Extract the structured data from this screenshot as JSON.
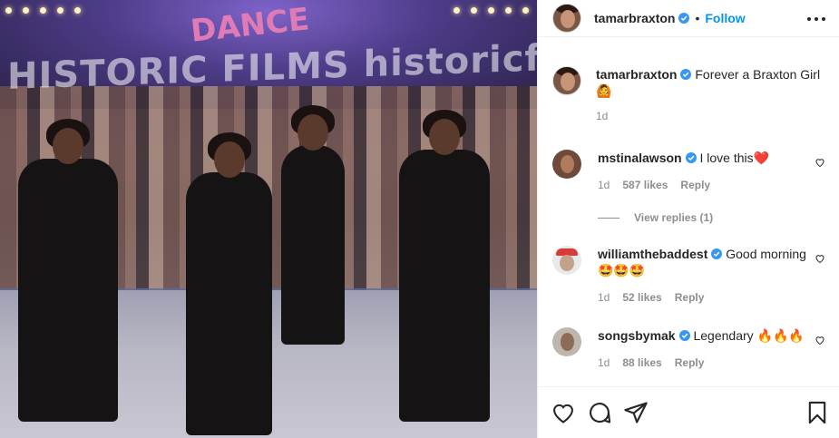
{
  "media": {
    "watermark": "HISTORIC FILMS  historicfilms.com",
    "sign": "DANCE"
  },
  "post": {
    "author": "tamarbraxton",
    "follow_label": "Follow",
    "separator": "•"
  },
  "caption": {
    "username": "tamarbraxton",
    "text": "Forever a Braxton Girl",
    "emoji": "🙆",
    "time": "1d"
  },
  "comments": [
    {
      "username": "mstinalawson",
      "text": "I love this❤️",
      "time": "1d",
      "likes": "587 likes",
      "reply_label": "Reply"
    },
    {
      "username": "williamthebaddest",
      "text": "Good morning 🤩🤩🤩",
      "time": "1d",
      "likes": "52 likes",
      "reply_label": "Reply"
    },
    {
      "username": "songsbymak",
      "text": "Legendary 🔥🔥🔥",
      "time": "1d",
      "likes": "88 likes",
      "reply_label": "Reply"
    }
  ],
  "view_replies": "View replies (1)",
  "colors": {
    "accent": "#0095f6",
    "verified": "#3897f0",
    "text": "#262626",
    "muted": "#8e8e8e",
    "border": "#efefef"
  },
  "icons": [
    "verified-badge-icon",
    "more-options-icon",
    "heart-outline-icon",
    "comment-icon",
    "share-icon",
    "bookmark-icon"
  ]
}
